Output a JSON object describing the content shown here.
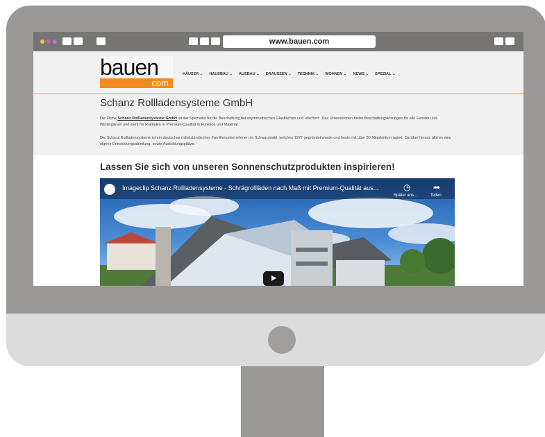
{
  "browser": {
    "url": "www.bauen.com",
    "dot_colors": [
      "#f6c23e",
      "#e6559e",
      "#b07acd"
    ]
  },
  "logo": {
    "top": "bauen",
    "bottom": "com",
    "accent": "#f5891f"
  },
  "nav": {
    "items": [
      {
        "label": "HÄUSER",
        "icon": "chevron-down-icon"
      },
      {
        "label": "HAUSBAU",
        "icon": "chevron-down-icon"
      },
      {
        "label": "AUSBAU",
        "icon": "chevron-down-icon"
      },
      {
        "label": "DRAUSSEN",
        "icon": "chevron-down-icon"
      },
      {
        "label": "TECHNIK",
        "icon": "chevron-down-icon"
      },
      {
        "label": "WOHNEN",
        "icon": "chevron-down-icon"
      },
      {
        "label": "NEWS",
        "icon": "chevron-down-icon"
      },
      {
        "label": "SPEZIAL",
        "icon": "chevron-down-icon"
      }
    ]
  },
  "article": {
    "title": "Schanz Rollladensysteme GmbH",
    "para1_prefix": "Die Firma ",
    "para1_link": "Schanz Rollladensysteme GmbH",
    "para1_suffix": " ist der Spezialist für die Beschattung bei asymmetrischen Glasflächen und -dächern. Das Unternehmen bietet Beschattungslösungen für alle Fenster und Wintergärten und steht für Rollläden in Premium-Qualität in Funktion und Material.",
    "para2": "Die Schanz Rollladensysteme ist ein deutsches mittelständisches Familienunternehmen im Schwarzwald, welches 1977 gegründet wurde und heute mit über 80 Mitarbeitern agiert. Darüber hinaus gibt es eine eigene Entwicklungsabteilung, sowie Ausbildungsplätze.",
    "heading": "Lassen Sie sich von unseren Sonnenschutzprodukten inspirieren!"
  },
  "video": {
    "title": "Imageclip Schanz Rollladensysteme - Schrägrollläden nach Maß mit Premium-Qualität aus...",
    "watch_later": "Später ans...",
    "share": "Teilen",
    "watch_later_icon": "clock-icon",
    "share_icon": "share-arrow-icon",
    "play_icon": "play-icon"
  }
}
